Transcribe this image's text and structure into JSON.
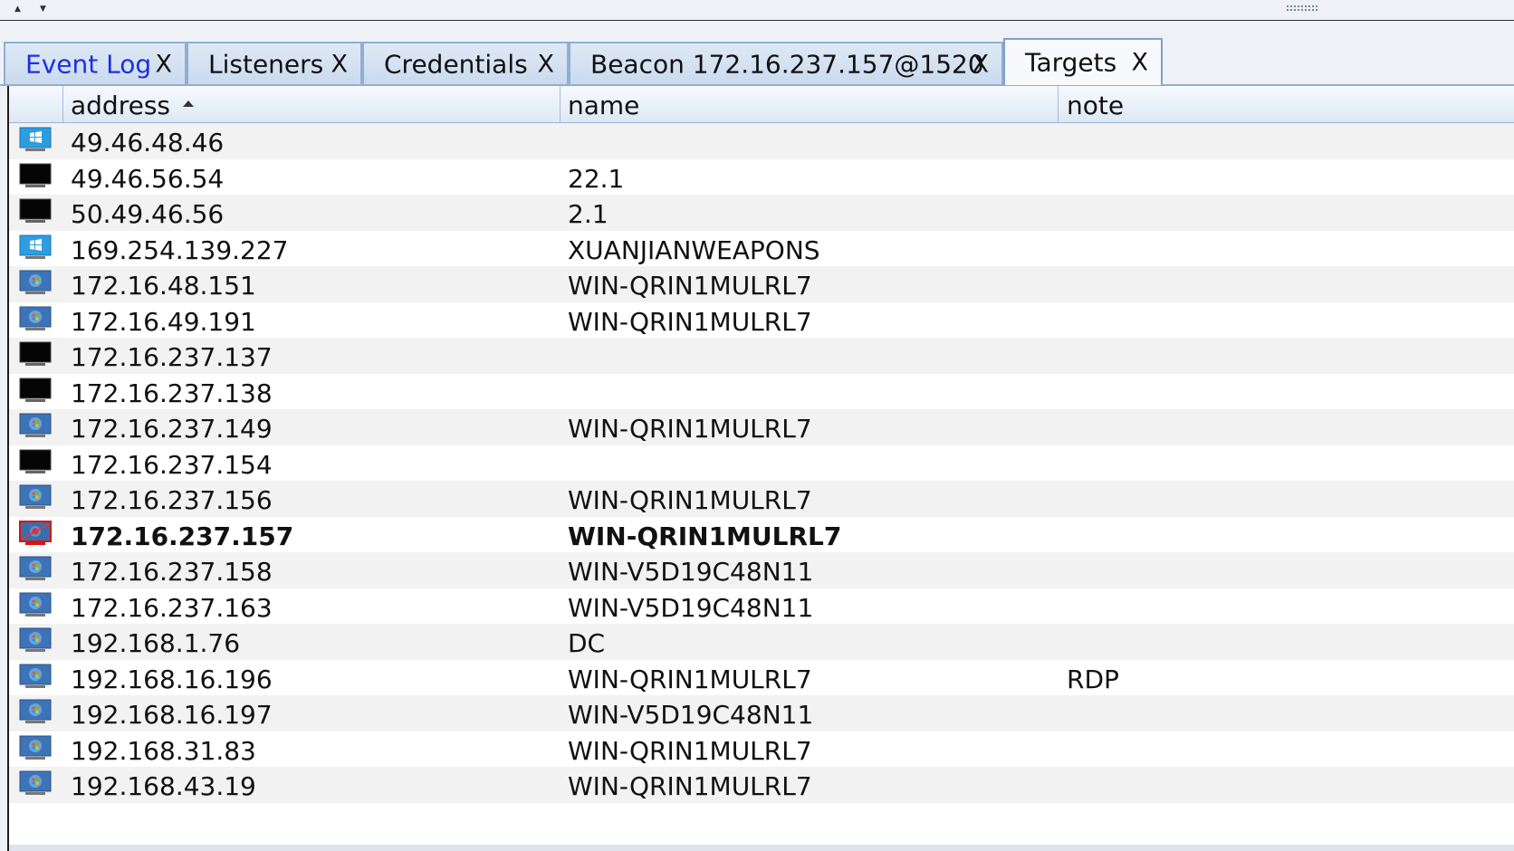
{
  "tabs": [
    {
      "label": "Event Log",
      "close": "X",
      "active": false
    },
    {
      "label": "Listeners",
      "close": "X",
      "active": false
    },
    {
      "label": "Credentials",
      "close": "X",
      "active": false
    },
    {
      "label": "Beacon 172.16.237.157@1520",
      "close": "X",
      "active": false
    },
    {
      "label": "Targets",
      "close": "X",
      "active": true
    }
  ],
  "table": {
    "columns": [
      "address",
      "name",
      "note"
    ],
    "sort_column": "address",
    "sort_order": "ascending",
    "rows": [
      {
        "icon": "windows-icon",
        "address": "49.46.48.46",
        "name": "",
        "note": ""
      },
      {
        "icon": "unknown-host-icon",
        "address": "49.46.56.54",
        "name": "22.1",
        "note": ""
      },
      {
        "icon": "unknown-host-icon",
        "address": "50.49.46.56",
        "name": "2.1",
        "note": ""
      },
      {
        "icon": "windows-icon",
        "address": "169.254.139.227",
        "name": "XUANJIANWEAPONS",
        "note": ""
      },
      {
        "icon": "windows-7-icon",
        "address": "172.16.48.151",
        "name": "WIN-QRIN1MULRL7",
        "note": ""
      },
      {
        "icon": "windows-7-icon",
        "address": "172.16.49.191",
        "name": "WIN-QRIN1MULRL7",
        "note": ""
      },
      {
        "icon": "unknown-host-icon",
        "address": "172.16.237.137",
        "name": "",
        "note": ""
      },
      {
        "icon": "unknown-host-icon",
        "address": "172.16.237.138",
        "name": "",
        "note": ""
      },
      {
        "icon": "windows-7-icon",
        "address": "172.16.237.149",
        "name": "WIN-QRIN1MULRL7",
        "note": ""
      },
      {
        "icon": "unknown-host-icon",
        "address": "172.16.237.154",
        "name": "",
        "note": ""
      },
      {
        "icon": "windows-7-icon",
        "address": "172.16.237.156",
        "name": "WIN-QRIN1MULRL7",
        "note": ""
      },
      {
        "icon": "compromised-host-icon",
        "address": "172.16.237.157",
        "name": "WIN-QRIN1MULRL7",
        "note": "",
        "bold": true
      },
      {
        "icon": "windows-7-icon",
        "address": "172.16.237.158",
        "name": "WIN-V5D19C48N11",
        "note": ""
      },
      {
        "icon": "windows-7-icon",
        "address": "172.16.237.163",
        "name": "WIN-V5D19C48N11",
        "note": ""
      },
      {
        "icon": "windows-7-icon",
        "address": "192.168.1.76",
        "name": "DC",
        "note": ""
      },
      {
        "icon": "windows-7-icon",
        "address": "192.168.16.196",
        "name": "WIN-QRIN1MULRL7",
        "note": "RDP"
      },
      {
        "icon": "windows-7-icon",
        "address": "192.168.16.197",
        "name": "WIN-V5D19C48N11",
        "note": ""
      },
      {
        "icon": "windows-7-icon",
        "address": "192.168.31.83",
        "name": "WIN-QRIN1MULRL7",
        "note": ""
      },
      {
        "icon": "windows-7-icon",
        "address": "192.168.43.19",
        "name": "WIN-QRIN1MULRL7",
        "note": ""
      }
    ]
  },
  "colors": {
    "active_tab_text": "#1d2fe0",
    "tab_border": "#8faed4",
    "row_alt": "#f2f2f2"
  }
}
